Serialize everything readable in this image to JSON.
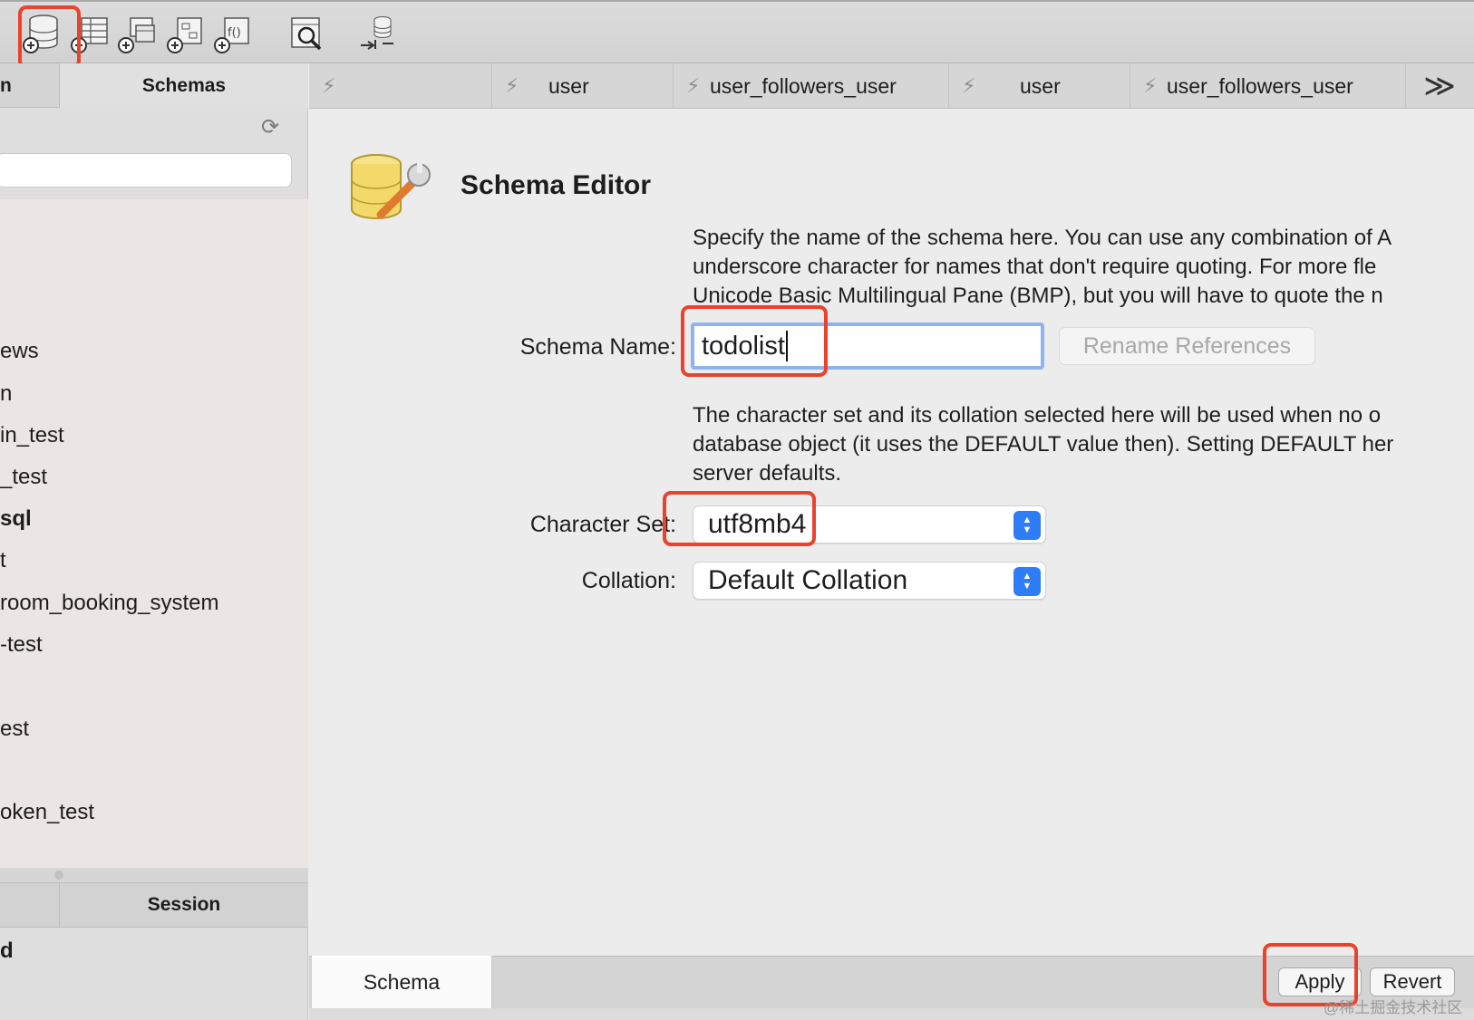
{
  "toolbar": {
    "buttons": [
      {
        "name": "new-schema-icon",
        "label": "new schema"
      },
      {
        "name": "new-table-icon",
        "label": "new table"
      },
      {
        "name": "new-view-icon",
        "label": "new view"
      },
      {
        "name": "new-procedure-icon",
        "label": "new procedure"
      },
      {
        "name": "new-function-icon",
        "label": "new function",
        "glyph": "f()"
      },
      {
        "name": "search-table-icon",
        "label": "search"
      },
      {
        "name": "reconnect-icon",
        "label": "reconnect"
      }
    ]
  },
  "sidebar": {
    "tab_left": "n",
    "tab_schemas": "Schemas",
    "refresh_icon": "refresh-icon",
    "search_placeholder": "",
    "items": [
      "ews",
      "n",
      "in_test",
      "_test",
      "sql",
      "t",
      "room_booking_system",
      "-test",
      "",
      "est",
      "",
      "oken_test"
    ],
    "bold_item_index": 4,
    "tab_session": "Session",
    "session_text": "d"
  },
  "query_tabs": [
    {
      "label": ""
    },
    {
      "label": "user"
    },
    {
      "label": "user_followers_user"
    },
    {
      "label": "user"
    },
    {
      "label": "user_followers_user"
    }
  ],
  "more_tabs_glyph": "≫",
  "editor": {
    "title": "Schema Editor",
    "desc1": [
      "Specify the name of the schema here. You can use any combination of A",
      "underscore character for names that don't require quoting. For more fle",
      "Unicode Basic Multilingual Pane (BMP), but you will have to quote the n"
    ],
    "schema_name_label": "Schema Name:",
    "schema_name_value": "todolist",
    "rename_button": "Rename References",
    "desc2": [
      "The character set and its collation selected here will be used when no o",
      "database object (it uses the DEFAULT value then). Setting DEFAULT her",
      "server defaults."
    ],
    "charset_label": "Character Set:",
    "charset_value": "utf8mb4",
    "collation_label": "Collation:",
    "collation_value": "Default Collation"
  },
  "bottom": {
    "tab_schema": "Schema",
    "apply": "Apply",
    "revert": "Revert"
  },
  "watermark": "@稀土掘金技术社区",
  "colors": {
    "highlight": "#e8432c",
    "focus_ring": "#8fb3f0",
    "select_stepper": "#2e7cf6"
  }
}
